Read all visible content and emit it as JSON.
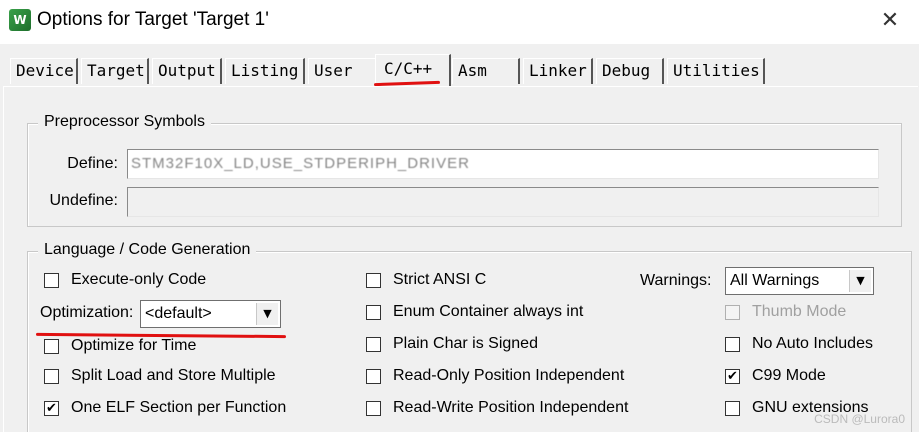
{
  "window": {
    "title": "Options for Target 'Target 1'",
    "close_glyph": "✕",
    "app_icon_glyph": "W"
  },
  "tabs": [
    {
      "label": "Device"
    },
    {
      "label": "Target"
    },
    {
      "label": "Output"
    },
    {
      "label": "Listing"
    },
    {
      "label": "User"
    },
    {
      "label": "C/C++",
      "active": true
    },
    {
      "label": "Asm"
    },
    {
      "label": "Linker"
    },
    {
      "label": "Debug"
    },
    {
      "label": "Utilities"
    }
  ],
  "preprocessor": {
    "title": "Preprocessor Symbols",
    "define_label": "Define:",
    "define_value": "STM32F10X_LD,USE_STDPERIPH_DRIVER",
    "undefine_label": "Undefine:",
    "undefine_value": ""
  },
  "language": {
    "title": "Language / Code Generation",
    "execute_only": {
      "label": "Execute-only Code",
      "checked": false
    },
    "optimization_label": "Optimization:",
    "optimization_value": "<default>",
    "optimize_time": {
      "label": "Optimize for Time",
      "checked": false
    },
    "split_load": {
      "label": "Split Load and Store Multiple",
      "checked": false
    },
    "one_elf": {
      "label": "One ELF Section per Function",
      "checked": true
    },
    "strict_ansi": {
      "label": "Strict ANSI C",
      "checked": false
    },
    "enum_container": {
      "label": "Enum Container always int",
      "checked": false
    },
    "plain_char": {
      "label": "Plain Char is Signed",
      "checked": false
    },
    "ro_pos_indep": {
      "label": "Read-Only Position Independent",
      "checked": false
    },
    "rw_pos_indep": {
      "label": "Read-Write Position Independent",
      "checked": false
    },
    "warnings_label": "Warnings:",
    "warnings_value": "All Warnings",
    "thumb_mode": {
      "label": "Thumb Mode",
      "checked": false,
      "disabled": true
    },
    "no_auto_includes": {
      "label": "No Auto Includes",
      "checked": false
    },
    "c99_mode": {
      "label": "C99 Mode",
      "checked": true
    },
    "gnu_extensions": {
      "label": "GNU extensions",
      "checked": false
    }
  },
  "check_glyph": "✔",
  "combo_arrow_glyph": "▼",
  "watermark": "CSDN @Lurora0",
  "colors": {
    "annotation_red": "#e01010",
    "window_bg": "#f0f0f0"
  }
}
